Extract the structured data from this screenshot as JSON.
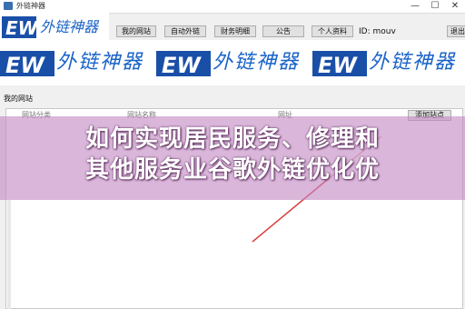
{
  "window": {
    "title": "外链神器",
    "minimize": "—",
    "maximize": "☐",
    "close": "✕"
  },
  "logo": {
    "badge": "EW",
    "text": "外链神器"
  },
  "nav": {
    "items": [
      "我的网站",
      "自动外链",
      "财务明细",
      "公告",
      "个人资料"
    ],
    "id_label": "ID: mouv",
    "logout": "退出"
  },
  "banner": {
    "badge": "EW",
    "text": "外链神器"
  },
  "section": {
    "title": "我的网站"
  },
  "table": {
    "columns": [
      "网站分类",
      "网站名称",
      "网址"
    ],
    "add_button": "添加站点"
  },
  "overlay": {
    "line1": "如何实现居民服务、修理和",
    "line2": "其他服务业谷歌外链优化优"
  },
  "colors": {
    "accent": "#1a63c8",
    "badge_bg": "#1a4fa8",
    "overlay": "#c489c4"
  }
}
